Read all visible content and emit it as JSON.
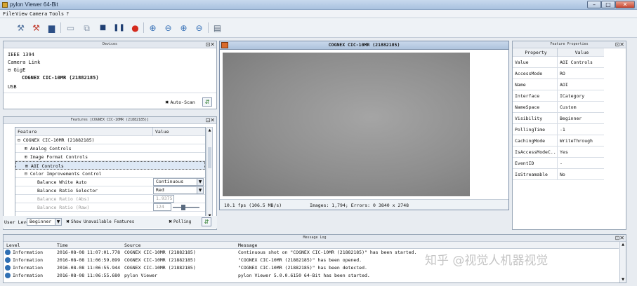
{
  "window": {
    "title": "pylon Viewer 64-Bit",
    "minimize": "–",
    "maximize": "□",
    "close": "✕"
  },
  "menu": [
    "File",
    "View",
    "Camera",
    "Tools",
    "?"
  ],
  "devices_panel": {
    "title": "Devices",
    "tree": [
      "IEEE 1394",
      "Camera Link",
      "GigE",
      "COGNEX CIC-10MR (21882185)",
      "USB"
    ],
    "auto_scan_label": "Auto-Scan"
  },
  "features_panel": {
    "title": "Features [COGNEX CIC-10MR (21882185)]",
    "col_feature": "Feature",
    "col_value": "Value",
    "rows": [
      {
        "label": "COGNEX CIC-10MR (21882185)",
        "value": ""
      },
      {
        "label": "Analog Controls",
        "value": ""
      },
      {
        "label": "Image Format Controls",
        "value": ""
      },
      {
        "label": "AOI Controls",
        "value": ""
      },
      {
        "label": "Color Improvements Control",
        "value": ""
      },
      {
        "label": "Balance White Auto",
        "value": "Continuous"
      },
      {
        "label": "Balance Ratio Selector",
        "value": "Red"
      },
      {
        "label": "Balance Ratio (Abs)",
        "value": "1.9375"
      },
      {
        "label": "Balance Ratio (Raw)",
        "value": "124"
      }
    ],
    "user_level_label": "User Level:",
    "user_level_value": "Beginner",
    "show_unavailable_label": "Show Unavailable Features",
    "polling_label": "Polling"
  },
  "image_view": {
    "title": "COGNEX CIC-10MR (21882185)",
    "fps": "10.1 fps (106.5 MB/s)",
    "images": "Images: 1,794; Errors: 0",
    "resolution": "3840 x 2748"
  },
  "feature_properties": {
    "title": "Feature Properties",
    "col_property": "Property",
    "col_value": "Value",
    "rows": [
      {
        "property": "Value",
        "value": "AOI Controls"
      },
      {
        "property": "AccessMode",
        "value": "RO"
      },
      {
        "property": "Name",
        "value": "AOI"
      },
      {
        "property": "Interface",
        "value": "ICategory"
      },
      {
        "property": "NameSpace",
        "value": "Custom"
      },
      {
        "property": "Visibility",
        "value": "Beginner"
      },
      {
        "property": "PollingTime",
        "value": "-1"
      },
      {
        "property": "CachingMode",
        "value": "WriteThrough"
      },
      {
        "property": "IsAccessModeC...",
        "value": "Yes"
      },
      {
        "property": "EventID",
        "value": "-"
      },
      {
        "property": "IsStreamable",
        "value": "No"
      }
    ]
  },
  "message_log": {
    "title": "Message Log",
    "columns": [
      "Level",
      "Time",
      "Source",
      "Message"
    ],
    "rows": [
      {
        "level": "Information",
        "time": "2016-08-08 11:07:01.778",
        "source": "COGNEX CIC-10MR (21882185)",
        "message": "Continuous shot on \"COGNEX CIC-10MR (21882185)\" has been started."
      },
      {
        "level": "Information",
        "time": "2016-08-08 11:06:59.899",
        "source": "COGNEX CIC-10MR (21882185)",
        "message": "\"COGNEX CIC-10MR (21882185)\" has been opened."
      },
      {
        "level": "Information",
        "time": "2016-08-08 11:06:55.944",
        "source": "COGNEX CIC-10MR (21882185)",
        "message": "\"COGNEX CIC-10MR (21882185)\" has been detected."
      },
      {
        "level": "Information",
        "time": "2016-08-08 11:06:55.680",
        "source": "pylon Viewer",
        "message": "pylon Viewer 5.0.0.6150 64-Bit has been started."
      }
    ],
    "watermark": "知乎 @视觉人机器视觉"
  },
  "colors": {
    "image_gray": "#8c8c8c",
    "selected_row": "#dde8f5",
    "accent": "#2f6fb3"
  }
}
